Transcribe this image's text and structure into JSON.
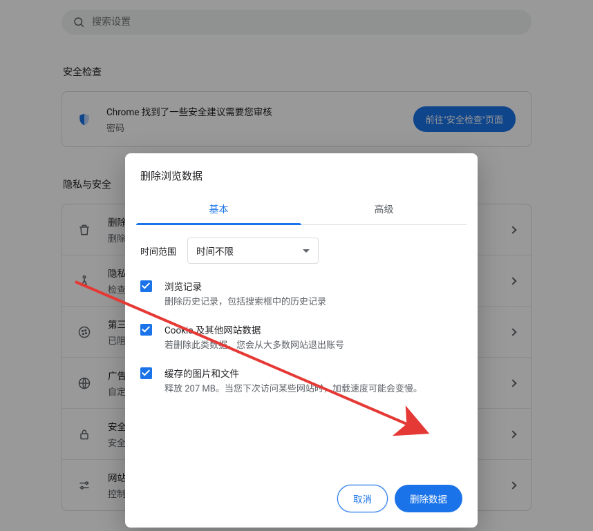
{
  "search": {
    "placeholder": "搜索设置"
  },
  "sections": {
    "safety_check_title": "安全检查",
    "privacy_title": "隐私与安全"
  },
  "safety_banner": {
    "title": "Chrome 找到了一些安全建议需要您审核",
    "sub": "密码",
    "button": "前往\"安全检查\"页面"
  },
  "rows": [
    {
      "title": "删除浏览数据",
      "sub": "删除浏览记录、Cookie、缓存及其他数据"
    },
    {
      "title": "隐私指南",
      "sub": "检查隐私与安全方面的重要设置"
    },
    {
      "title": "第三方 Cookie",
      "sub": "已阻止无痕模式下的第三方 Cookie"
    },
    {
      "title": "广告隐私权设置",
      "sub": "自定义网站用于向您展示广告的信息"
    },
    {
      "title": "安全",
      "sub": "安全浏览和其他安全设置"
    },
    {
      "title": "网站设置",
      "sub": "控制网站可以使用和显示的信息"
    }
  ],
  "modal": {
    "title": "删除浏览数据",
    "tabs": {
      "basic": "基本",
      "advanced": "高级"
    },
    "time_label": "时间范围",
    "time_value": "时间不限",
    "items": [
      {
        "title": "浏览记录",
        "sub": "删除历史记录，包括搜索框中的历史记录"
      },
      {
        "title": "Cookie 及其他网站数据",
        "sub": "若删除此类数据，您会从大多数网站退出账号"
      },
      {
        "title": "缓存的图片和文件",
        "sub": "释放 207 MB。当您下次访问某些网站时，加载速度可能会变慢。"
      }
    ],
    "cancel": "取消",
    "confirm": "删除数据"
  }
}
